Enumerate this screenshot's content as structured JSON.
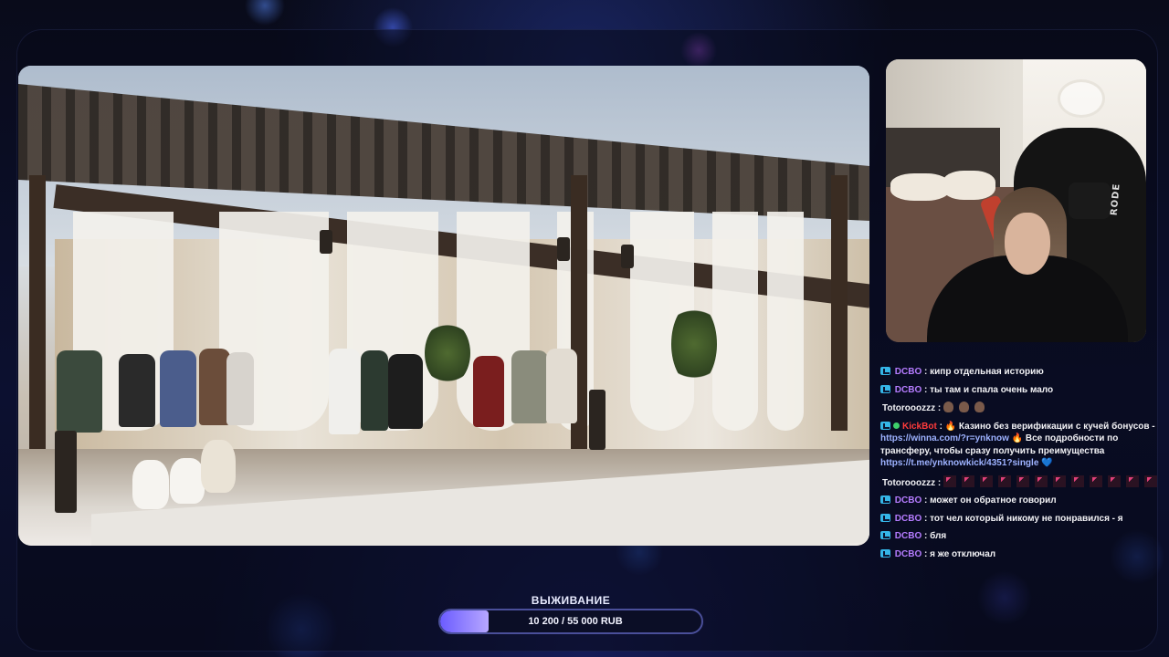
{
  "colors": {
    "background": "#0a0c1c",
    "accent": "#7b6bff",
    "username_default": "#b57cff",
    "username_bot": "#ff3b3b",
    "username_alt": "#f2f2f5",
    "link": "#9db2ff"
  },
  "chat": {
    "messages": [
      {
        "user": "DCBO",
        "user_color": "#b57cff",
        "badges": [
          "kick-icon"
        ],
        "text": "кипр отдельная историю"
      },
      {
        "user": "DCBO",
        "user_color": "#b57cff",
        "badges": [
          "kick-icon"
        ],
        "text": "ты там и спала очень мало"
      },
      {
        "user": "Totorooozzz",
        "user_color": "#f2f2f5",
        "badges": [],
        "emotes": [
          "emoji-face-icon",
          "emoji-face-icon",
          "emoji-face-icon"
        ]
      },
      {
        "user": "KickBot",
        "user_color": "#ff3b3b",
        "badges": [
          "kick-icon",
          "bot-icon"
        ],
        "parts": [
          {
            "type": "fire",
            "text": "🔥"
          },
          {
            "type": "text",
            "text": " Казино без верификации с кучей бонусов - "
          },
          {
            "type": "link",
            "text": "https://winna.com/?r=ynknow"
          },
          {
            "type": "fire",
            "text": " 🔥 "
          },
          {
            "type": "text",
            "text": "Все подробности по трансферу, чтобы сразу получить преимущества "
          },
          {
            "type": "link",
            "text": "https://t.me/ynknowkick/4351?single"
          },
          {
            "type": "heart",
            "text": " 💙"
          }
        ]
      },
      {
        "user": "Totorooozzz",
        "user_color": "#f2f2f5",
        "badges": [],
        "emote_count": 12
      },
      {
        "user": "DCBO",
        "user_color": "#b57cff",
        "badges": [
          "kick-icon"
        ],
        "text": "может он обратное говорил"
      },
      {
        "user": "DCBO",
        "user_color": "#b57cff",
        "badges": [
          "kick-icon"
        ],
        "text": "тот чел который никому не понравился - я"
      },
      {
        "user": "DCBO",
        "user_color": "#b57cff",
        "badges": [
          "kick-icon"
        ],
        "text": "бля"
      },
      {
        "user": "DCBO",
        "user_color": "#b57cff",
        "badges": [
          "kick-icon"
        ],
        "text": "я же отключал"
      }
    ],
    "separator": " : "
  },
  "webcam": {
    "mic_label": "RODE"
  },
  "goal": {
    "title": "ВЫЖИВАНИЕ",
    "current": 10200,
    "target": 55000,
    "label": "10 200 / 55 000 RUB",
    "progress": 0.185
  }
}
